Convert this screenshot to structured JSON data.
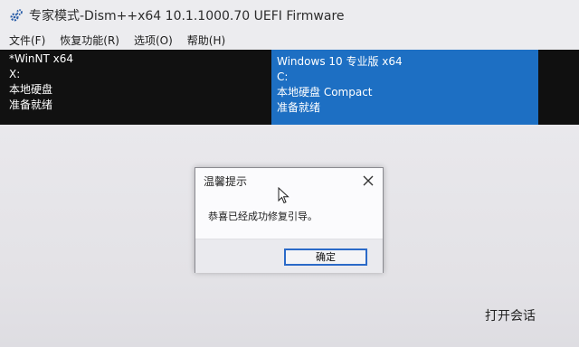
{
  "window": {
    "title": "专家模式-Dism++x64 10.1.1000.70 UEFI Firmware",
    "app_icon": "gear-icon"
  },
  "menu": {
    "items": [
      "文件(F)",
      "恢复功能(R)",
      "选项(O)",
      "帮助(H)"
    ]
  },
  "sessions": [
    {
      "name": "*WinNT x64",
      "drive": "X:",
      "disk": "本地硬盘",
      "status": "准备就绪",
      "selected": false
    },
    {
      "name": "Windows 10 专业版 x64",
      "drive": "C:",
      "disk": "本地硬盘 Compact",
      "status": "准备就绪",
      "selected": true
    }
  ],
  "dialog": {
    "title": "温馨提示",
    "message": "恭喜已经成功修复引导。",
    "ok_label": "确定",
    "close_icon": "close-icon"
  },
  "footer": {
    "open_session_label": "打开会话"
  },
  "colors": {
    "selection": "#1d6fc3",
    "session_bg": "#111111",
    "button_border": "#2b6ac8"
  }
}
